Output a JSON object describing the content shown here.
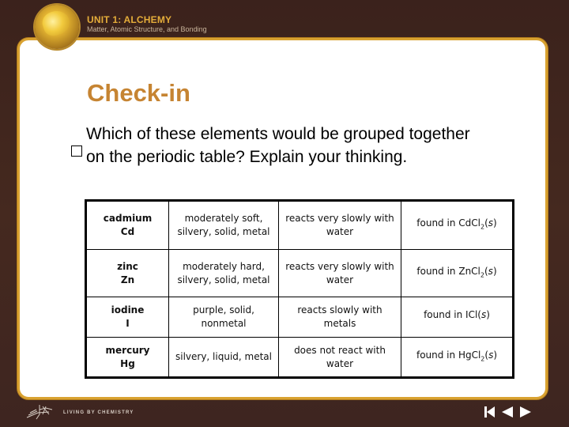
{
  "header": {
    "unit_title": "UNIT 1: ALCHEMY",
    "unit_subtitle": "Matter, Atomic Structure, and Bonding",
    "medallion_icon": "gold-nugget-icon"
  },
  "slide": {
    "heading": "Check-in",
    "question": "Which of these elements would be grouped together on the periodic table? Explain your thinking.",
    "bullet_icon": "square-bullet-icon"
  },
  "table": {
    "rows": [
      {
        "name": "cadmium",
        "symbol": "Cd",
        "appearance": "moderately soft, silvery, solid, metal",
        "reactivity": "reacts very slowly with water",
        "found_prefix": "found in ",
        "compound_main": "CdCl",
        "compound_sub": "2",
        "state": "s"
      },
      {
        "name": "zinc",
        "symbol": "Zn",
        "appearance": "moderately hard, silvery, solid, metal",
        "reactivity": "reacts very slowly with water",
        "found_prefix": "found in ",
        "compound_main": "ZnCl",
        "compound_sub": "2",
        "state": "s"
      },
      {
        "name": "iodine",
        "symbol": "I",
        "appearance": "purple, solid, nonmetal",
        "reactivity": "reacts slowly with metals",
        "found_prefix": "found in ",
        "compound_main": "ICl",
        "compound_sub": "",
        "state": "s"
      },
      {
        "name": "mercury",
        "symbol": "Hg",
        "appearance": "silvery, liquid, metal",
        "reactivity": "does not react with water",
        "found_prefix": "found in ",
        "compound_main": "HgCl",
        "compound_sub": "2",
        "state": "s"
      }
    ]
  },
  "footer": {
    "brand_text": "LIVING BY CHEMISTRY",
    "nav": {
      "first": "first-slide-icon",
      "prev": "previous-slide-icon",
      "next": "next-slide-icon"
    }
  },
  "colors": {
    "background": "#3f2620",
    "frame_gold": "#d9a231",
    "heading": "#c68432",
    "unit_title": "#e5ad3a"
  }
}
